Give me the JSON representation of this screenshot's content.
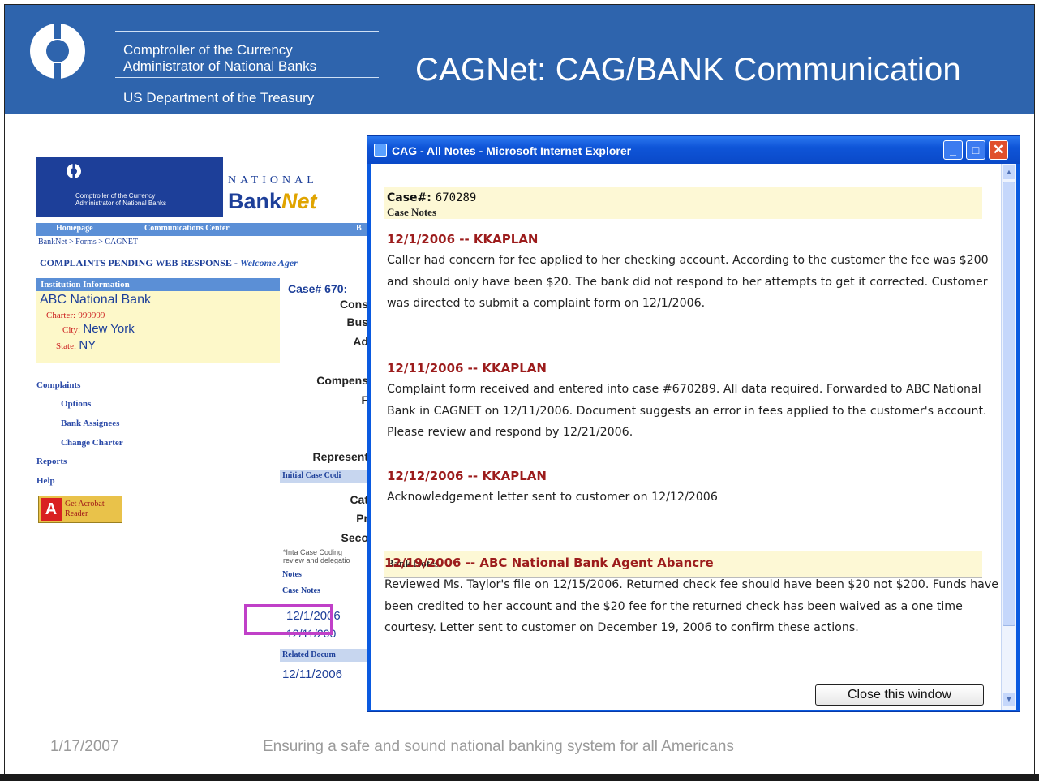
{
  "slide": {
    "org_line1": "Comptroller of the Currency",
    "org_line2": "Administrator of National Banks",
    "org_line3": "US Department of the Treasury",
    "title": "CAGNet: CAG/BANK Communication",
    "footer_date": "1/17/2007",
    "footer_tagline": "Ensuring a safe and sound national banking system for all Americans"
  },
  "banknet": {
    "banner_text_line1": "Comptroller of the Currency",
    "banner_text_line2": "Administrator of National Banks",
    "national": "NATIONAL",
    "bank": "Bank",
    "net": "Net",
    "nav": [
      "Homepage",
      "Communications Center",
      "B"
    ],
    "breadcrumb": "BankNet > Forms > CAGNET",
    "pending_title": "COMPLAINTS PENDING WEB RESPONSE - ",
    "pending_welcome": "Welcome Ager",
    "institution_header": "Institution Information",
    "bank_name": "ABC National Bank",
    "charter_label": "Charter:",
    "charter_value": "999999",
    "city_label": "City:",
    "city_value": "New York",
    "state_label": "State:",
    "state_value": "NY",
    "sidebar": [
      "Complaints",
      "Options",
      "Bank Assignees",
      "Change Charter",
      "Reports",
      "Help"
    ],
    "acrobat": [
      "Get Acrobat",
      "Reader"
    ],
    "case_col": {
      "case": "Case# 670:",
      "labels": [
        "Cons",
        "Bus",
        "Ad",
        "Compens",
        "F",
        "Represent",
        "Cat",
        "Pr",
        "Seco"
      ],
      "initial_case_coding": "Initial Case Codi",
      "coding_note_1": "*Inta Case Coding",
      "coding_note_2": "review and delegatio",
      "notes": "Notes",
      "case_notes": "Case Notes",
      "date1": "12/1/2006",
      "date2": "12/11/200",
      "related_docs": "Related Docum",
      "date3": "12/11/2006"
    }
  },
  "ie": {
    "title": "CAG - All Notes - Microsoft Internet Explorer",
    "case_label": "Case#:",
    "case_number": "670289",
    "case_notes_label": "Case Notes",
    "bank_notes_label": "Bank Notes",
    "close_button": "Close this window",
    "notes": [
      {
        "head": "12/1/2006 -- KKAPLAN",
        "body": "Caller had concern for fee applied to her checking account.  According to the customer the fee was $200 and should only have been $20.  The bank did not respond to her attempts to get it corrected.  Customer was directed to submit a complaint form on 12/1/2006."
      },
      {
        "head": "12/11/2006 -- KKAPLAN",
        "body": "Complaint form received and entered into case #670289.  All data required.  Forwarded to ABC National Bank in CAGNET on 12/11/2006.  Document suggests an error in fees applied to the customer's account.  Please review and respond by 12/21/2006."
      },
      {
        "head": "12/12/2006 -- KKAPLAN",
        "body": "Acknowledgement letter sent to customer on 12/12/2006"
      }
    ],
    "bank_note": {
      "head": "12/19/2006 -- ABC National Bank Agent Abancre",
      "body": "Reviewed Ms. Taylor's file on 12/15/2006.  Returned check fee should have been $20 not $200. Funds have been credited to her account and the $20 fee for the returned check has been waived as a one time courtesy.  Letter sent to customer on December 19, 2006 to confirm these actions."
    }
  },
  "colors": {
    "header_blue": "#2e64ad",
    "note_red": "#9c1c1c",
    "highlight_magenta": "#c040c8",
    "ie_titlebar": "#0a5ae0"
  }
}
